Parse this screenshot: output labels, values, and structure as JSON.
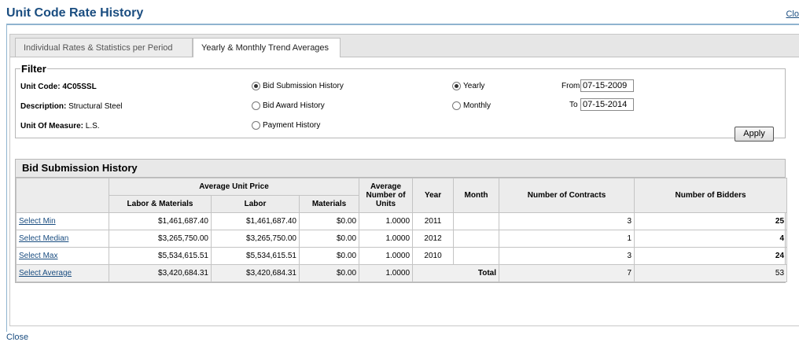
{
  "page": {
    "title": "Unit Code Rate History",
    "close_top": "Clo",
    "close_bottom": "Close"
  },
  "tabs": [
    {
      "label": "Individual Rates & Statistics per Period",
      "active": false
    },
    {
      "label": "Yearly & Monthly Trend Averages",
      "active": true
    }
  ],
  "filter": {
    "legend": "Filter",
    "unit_code_label": "Unit Code:",
    "unit_code_value": "4C05SSL",
    "description_label": "Description:",
    "description_value": "Structural Steel",
    "uom_label": "Unit Of Measure:",
    "uom_value": "L.S.",
    "history_options": [
      {
        "label": "Bid Submission History",
        "checked": true
      },
      {
        "label": "Bid Award History",
        "checked": false
      },
      {
        "label": "Payment History",
        "checked": false
      }
    ],
    "period_options": [
      {
        "label": "Yearly",
        "checked": true
      },
      {
        "label": "Monthly",
        "checked": false
      }
    ],
    "from_label": "From",
    "from_value": "07-15-2009",
    "to_label": "To",
    "to_value": "07-15-2014",
    "apply_label": "Apply"
  },
  "grid": {
    "caption": "Bid Submission History",
    "headers": {
      "avg_unit_price": "Average Unit Price",
      "labor_materials": "Labor & Materials",
      "labor": "Labor",
      "materials": "Materials",
      "avg_units": "Average Number of Units",
      "year": "Year",
      "month": "Month",
      "contracts": "Number of Contracts",
      "bidders": "Number of Bidders"
    },
    "rows": [
      {
        "link": "Select Min",
        "labor_materials": "$1,461,687.40",
        "labor": "$1,461,687.40",
        "materials": "$0.00",
        "units": "1.0000",
        "year": "2011",
        "month": "",
        "contracts": "3",
        "bidders": "25"
      },
      {
        "link": "Select Median",
        "labor_materials": "$3,265,750.00",
        "labor": "$3,265,750.00",
        "materials": "$0.00",
        "units": "1.0000",
        "year": "2012",
        "month": "",
        "contracts": "1",
        "bidders": "4"
      },
      {
        "link": "Select Max",
        "labor_materials": "$5,534,615.51",
        "labor": "$5,534,615.51",
        "materials": "$0.00",
        "units": "1.0000",
        "year": "2010",
        "month": "",
        "contracts": "3",
        "bidders": "24"
      }
    ],
    "average": {
      "link": "Select Average",
      "labor_materials": "$3,420,684.31",
      "labor": "$3,420,684.31",
      "materials": "$0.00",
      "units": "1.0000",
      "total_label": "Total",
      "contracts": "7",
      "bidders": "53"
    }
  }
}
